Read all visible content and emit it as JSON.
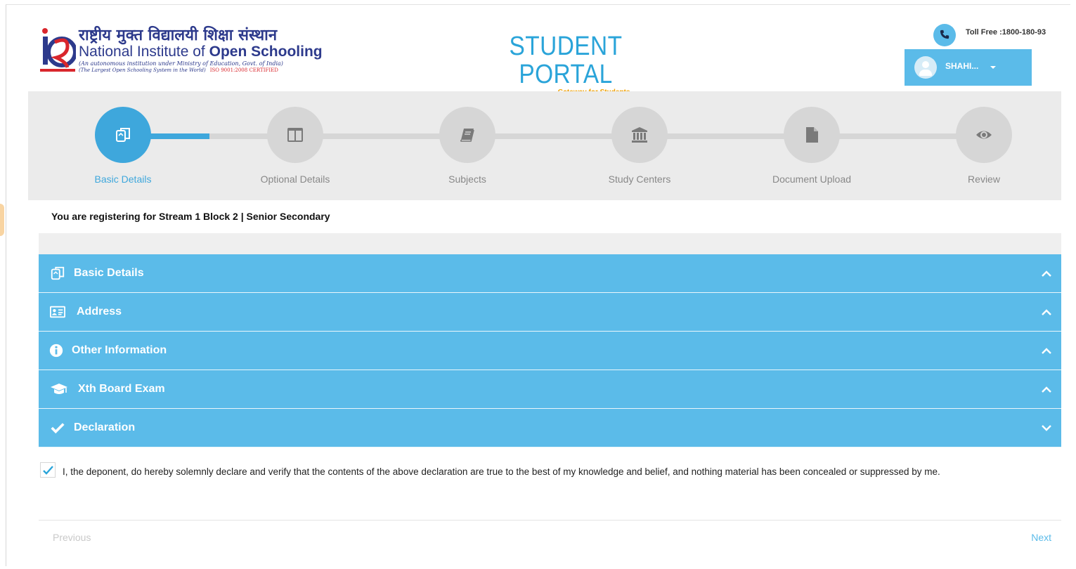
{
  "header": {
    "org_name_hindi": "राष्ट्रीय मुक्त विद्यालयी शिक्षा संस्थान",
    "org_name_en_prefix": "National Institute of ",
    "org_name_en_bold": "Open Schooling",
    "org_tagline": "(An autonomous institution under Ministry of Education, Govt. of India)",
    "org_tagline2": "(The Largest Open Schooling System in the World)",
    "iso_note": "ISO 9001:2008 CERTIFIED",
    "portal_title": "STUDENT PORTAL",
    "portal_subtitle": "Gateway for Students",
    "toll_free": "Toll Free :1800-180-93",
    "user_name": "SHAHI..."
  },
  "stepper": {
    "steps": [
      {
        "label": "Basic Details",
        "icon": "copy-icon",
        "active": true
      },
      {
        "label": "Optional Details",
        "icon": "columns-icon",
        "active": false
      },
      {
        "label": "Subjects",
        "icon": "book-icon",
        "active": false
      },
      {
        "label": "Study Centers",
        "icon": "bank-icon",
        "active": false
      },
      {
        "label": "Document Upload",
        "icon": "file-icon",
        "active": false
      },
      {
        "label": "Review",
        "icon": "eye-icon",
        "active": false
      }
    ],
    "progress_fraction": 0.1
  },
  "registration_note": "You are registering for Stream 1 Block 2 | Senior Secondary",
  "accordion": {
    "sections": [
      {
        "title": "Basic Details",
        "icon": "copy-icon",
        "expanded": false
      },
      {
        "title": "Address",
        "icon": "address-card-icon",
        "expanded": false
      },
      {
        "title": "Other Information",
        "icon": "info-circle-icon",
        "expanded": false
      },
      {
        "title": "Xth Board Exam",
        "icon": "graduation-cap-icon",
        "expanded": false
      },
      {
        "title": "Declaration",
        "icon": "check-icon",
        "expanded": true
      }
    ]
  },
  "declaration": {
    "checked": true,
    "text": "I, the deponent, do hereby solemnly declare and verify that the contents of the above declaration are true to the best of my knowledge and belief, and nothing material has been concealed or suppressed by me."
  },
  "navigation": {
    "previous_label": "Previous",
    "next_label": "Next"
  },
  "colors": {
    "primary": "#5bbbe9",
    "active_step": "#3ea7dc",
    "brand_blue": "#2d3a8c",
    "accent_orange": "#f0a000"
  }
}
